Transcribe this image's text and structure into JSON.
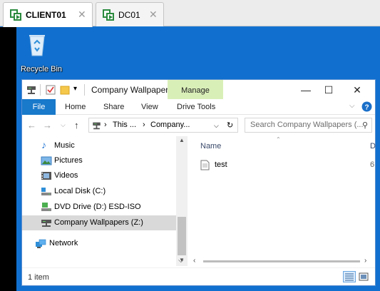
{
  "host_tabs": [
    {
      "label": "CLIENT01",
      "active": true
    },
    {
      "label": "DC01",
      "active": false
    }
  ],
  "desktop": {
    "recycle_bin_label": "Recycle Bin"
  },
  "explorer": {
    "title": "Company Wallpaper...",
    "context_tab": "Manage",
    "ribbon_tabs": {
      "file": "File",
      "home": "Home",
      "share": "Share",
      "view": "View",
      "drive_tools": "Drive Tools"
    },
    "address": {
      "segment1": "This ...",
      "segment2": "Company..."
    },
    "search_placeholder": "Search Company Wallpapers (...",
    "nav_items": [
      {
        "label": "Music",
        "icon": "music-icon"
      },
      {
        "label": "Pictures",
        "icon": "pictures-icon"
      },
      {
        "label": "Videos",
        "icon": "videos-icon"
      },
      {
        "label": "Local Disk (C:)",
        "icon": "local-disk-icon"
      },
      {
        "label": "DVD Drive (D:) ESD-ISO",
        "icon": "dvd-drive-icon"
      },
      {
        "label": "Company Wallpapers (Z:)",
        "icon": "network-drive-icon",
        "selected": true
      },
      {
        "label": "Network",
        "icon": "network-icon"
      }
    ],
    "columns": {
      "name": "Name",
      "second_col_fragment": "D"
    },
    "files": [
      {
        "name": "test",
        "icon": "text-file-icon",
        "second_col_fragment": "6"
      }
    ],
    "status_text": "1 item"
  },
  "colors": {
    "desktop": "#1170cf",
    "file_tab": "#1979ca",
    "manage_tab": "#d9efb8",
    "selected_nav": "#d9d9d9"
  }
}
